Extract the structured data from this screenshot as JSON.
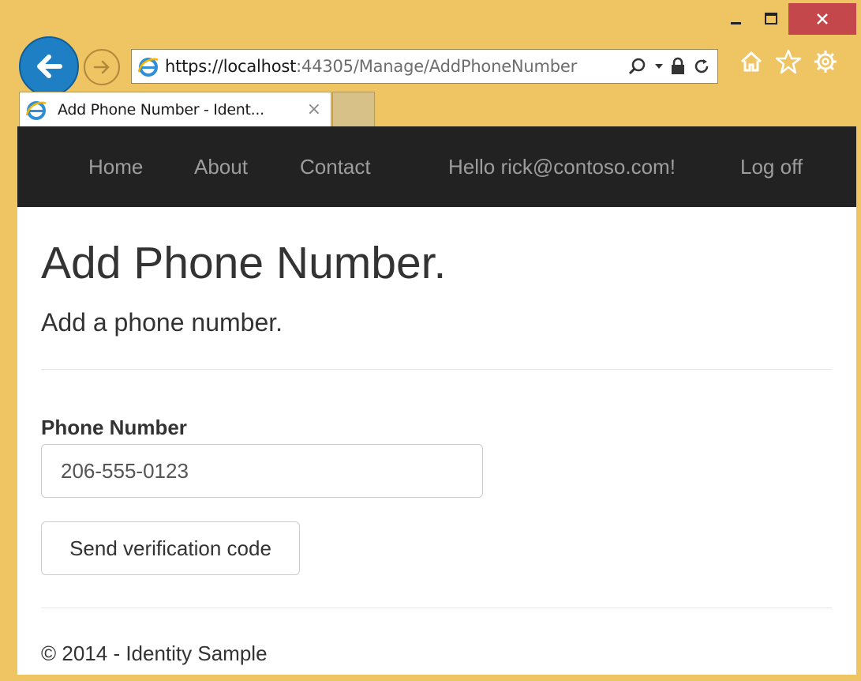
{
  "browser": {
    "url_scheme": "https://",
    "url_host": "localhost",
    "url_rest": ":44305/Manage/AddPhoneNumber",
    "tab_title": "Add Phone Number - Ident...",
    "tab_close": "×",
    "frame_color": "#efc462",
    "back_color": "#1f7fc5",
    "close_color": "#c4474c"
  },
  "nav": {
    "home": "Home",
    "about": "About",
    "contact": "Contact",
    "greeting": "Hello rick@contoso.com!",
    "logoff": "Log off",
    "background": "#222222",
    "link_color": "#9d9d9d"
  },
  "page": {
    "title": "Add Phone Number.",
    "subtitle": "Add a phone number.",
    "field_label": "Phone Number",
    "phone_value": "206-555-0123",
    "submit_label": "Send verification code",
    "footer": "© 2014 - Identity Sample"
  }
}
